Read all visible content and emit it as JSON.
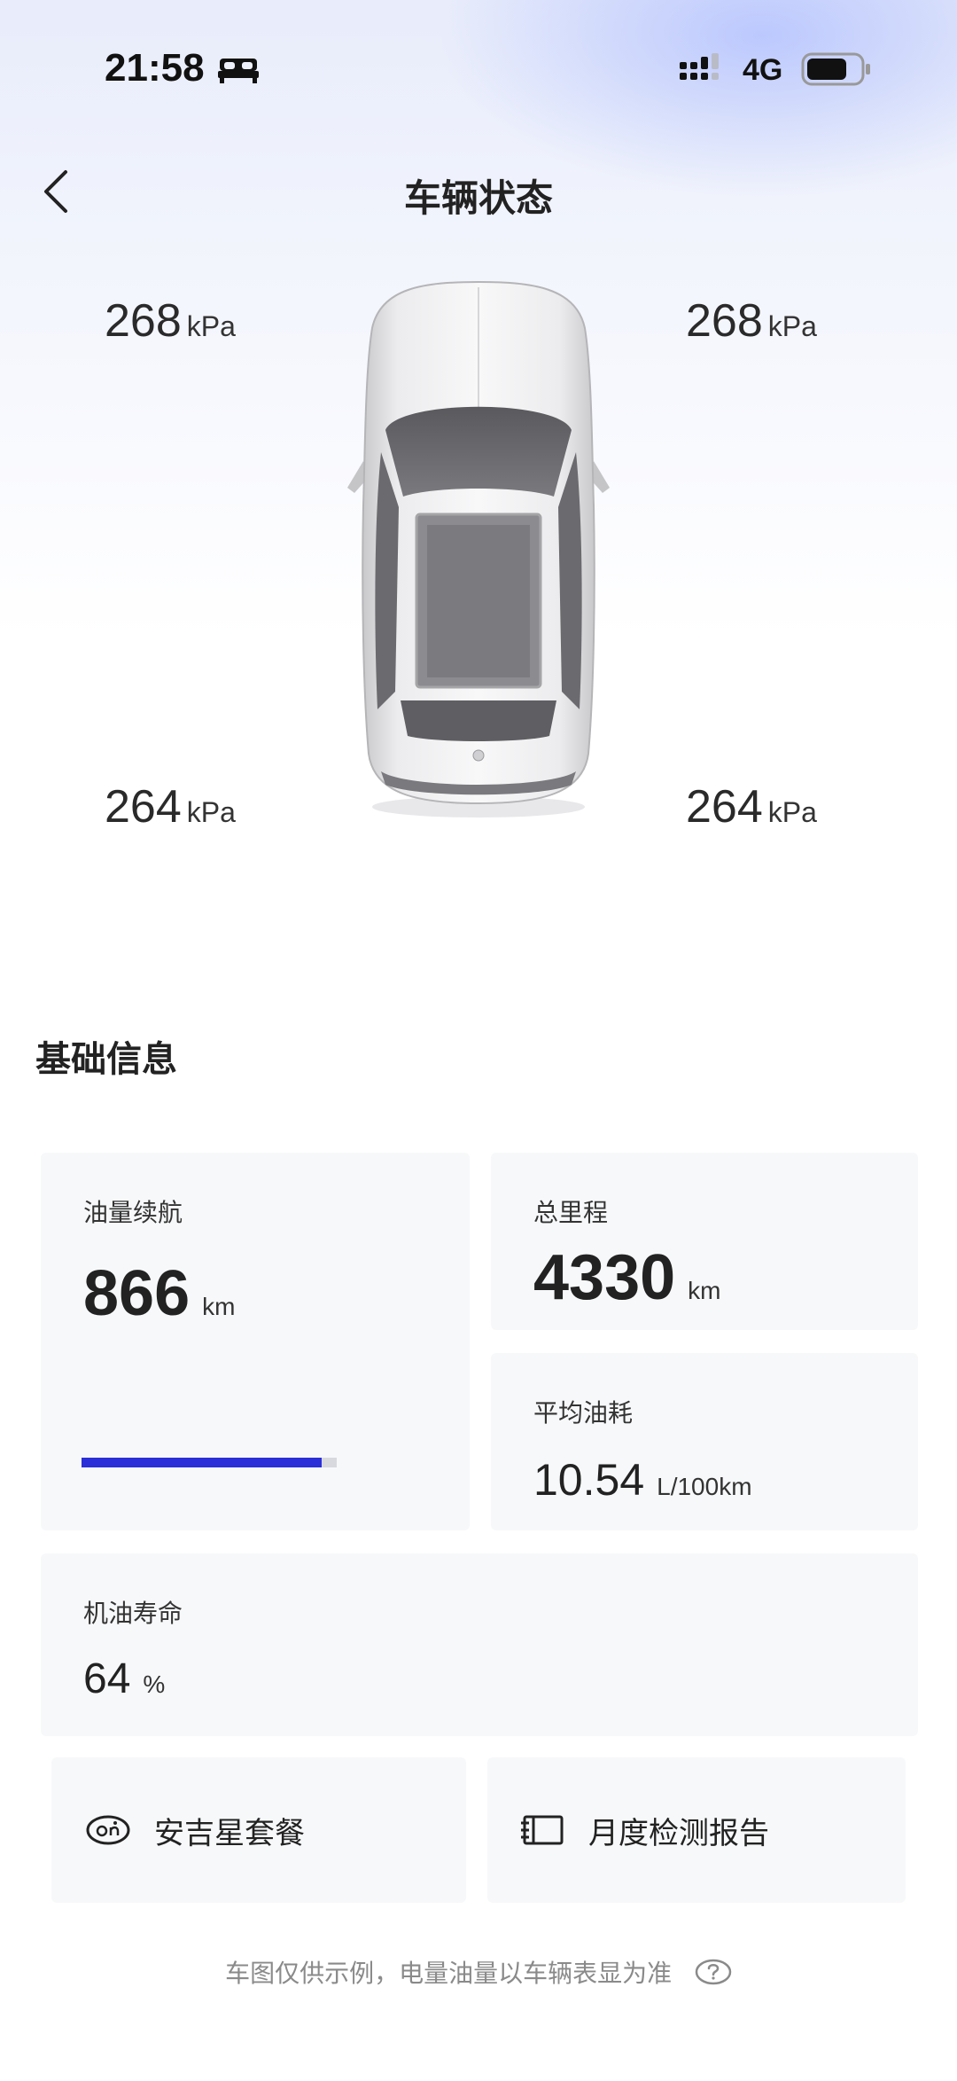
{
  "status_bar": {
    "time": "21:58",
    "network": "4G"
  },
  "header": {
    "title": "车辆状态"
  },
  "tires": {
    "front_left": {
      "value": "268",
      "unit": "kPa"
    },
    "front_right": {
      "value": "268",
      "unit": "kPa"
    },
    "rear_left": {
      "value": "264",
      "unit": "kPa"
    },
    "rear_right": {
      "value": "264",
      "unit": "kPa"
    }
  },
  "basic_info": {
    "title": "基础信息",
    "fuel_range": {
      "label": "油量续航",
      "value": "866",
      "unit": "km",
      "level_fraction": 0.94
    },
    "odometer": {
      "label": "总里程",
      "value": "4330",
      "unit": "km"
    },
    "avg_consumption": {
      "label": "平均油耗",
      "value": "10.54",
      "unit": "L/100km"
    },
    "oil_life": {
      "label": "机油寿命",
      "value": "64",
      "unit": "%"
    }
  },
  "actions": {
    "package_label": "安吉星套餐",
    "report_label": "月度检测报告"
  },
  "footnote": {
    "text": "车图仅供示例，电量油量以车辆表显为准"
  },
  "colors": {
    "accent": "#2b2fd8",
    "card_bg": "#f7f8fa"
  },
  "icons": [
    "sleep-icon",
    "signal-icon",
    "battery-icon",
    "back-icon",
    "car-image",
    "onstar-icon",
    "report-icon",
    "help-icon"
  ]
}
